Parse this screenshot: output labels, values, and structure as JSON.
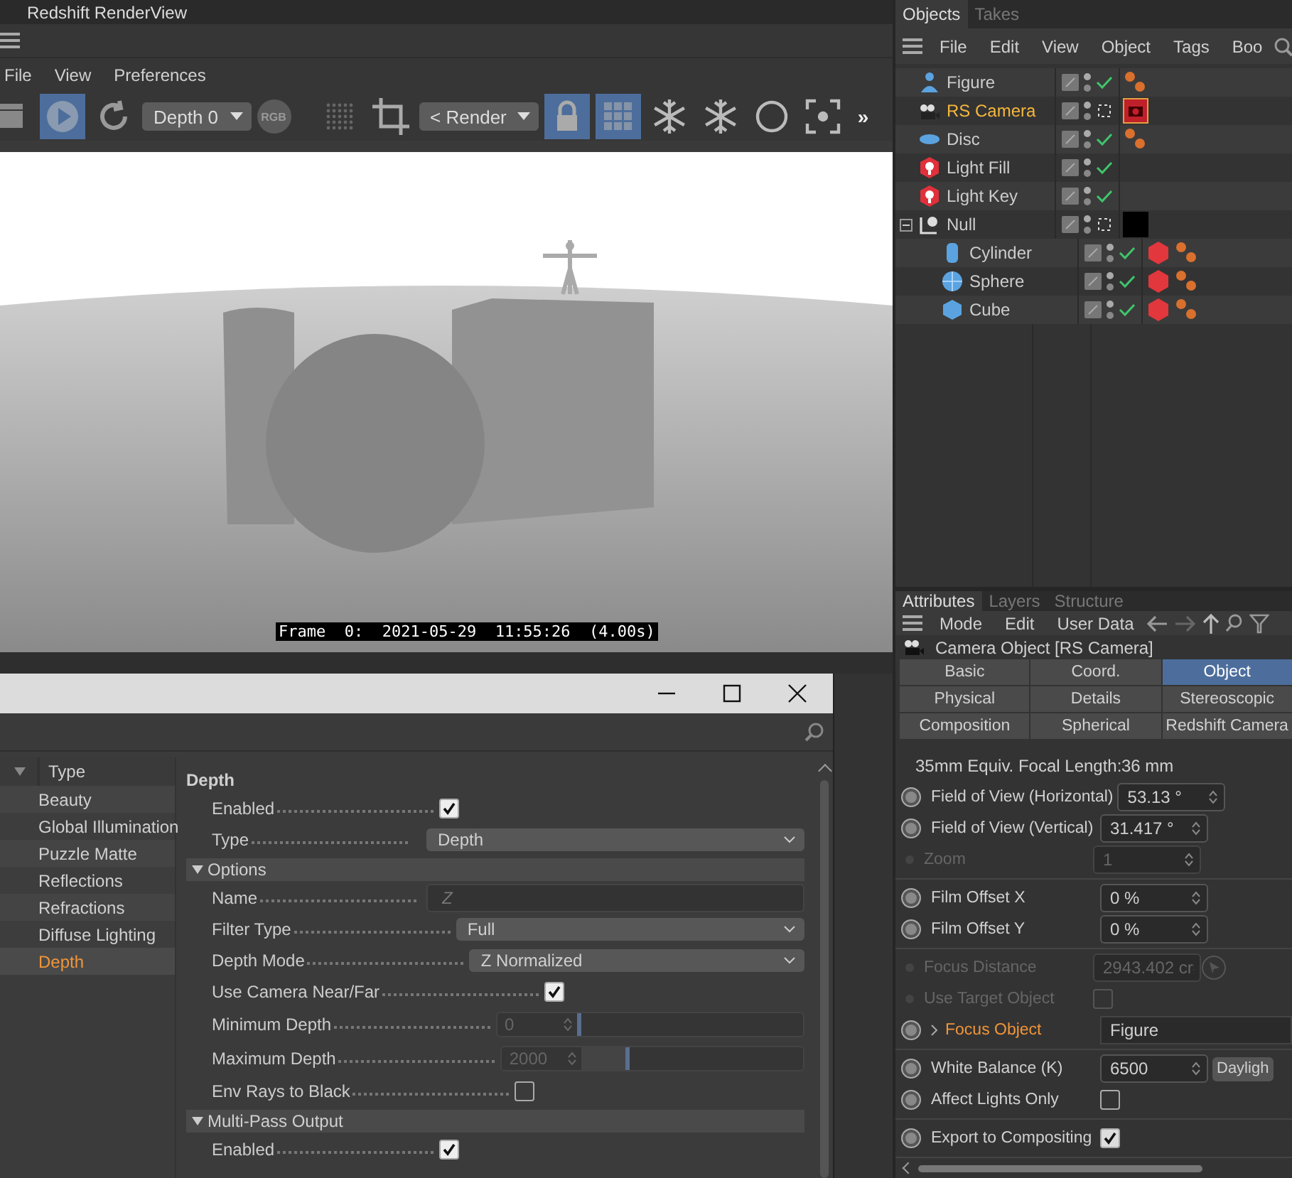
{
  "renderview": {
    "title": "Redshift RenderView",
    "menu": [
      "File",
      "View",
      "Preferences"
    ],
    "toolbar": [
      {
        "kind": "clapper",
        "on": false
      },
      {
        "kind": "play",
        "on": true
      },
      {
        "kind": "refresh",
        "on": false
      },
      {
        "kind": "select",
        "label": "Depth 0",
        "on": false
      },
      {
        "kind": "rgb",
        "label": "RGB",
        "on": false
      },
      {
        "kind": "dots",
        "on": false
      },
      {
        "kind": "crop",
        "on": false
      },
      {
        "kind": "select",
        "label": "< Render",
        "on": false
      },
      {
        "kind": "lock",
        "on": true
      },
      {
        "kind": "grid",
        "on": true
      },
      {
        "kind": "snowflake",
        "on": false
      },
      {
        "kind": "snowflake-g",
        "on": false
      },
      {
        "kind": "circle",
        "on": false
      },
      {
        "kind": "focus",
        "on": false
      },
      {
        "kind": "more",
        "label": "»",
        "on": false
      }
    ],
    "frame_label": "Frame  0:  2021-05-29  11:55:26  (4.00s)"
  },
  "objects": {
    "tabs": [
      {
        "label": "Objects",
        "selected": true
      },
      {
        "label": "Takes",
        "selected": false
      }
    ],
    "menu": [
      "File",
      "Edit",
      "View",
      "Object",
      "Tags",
      "Boo"
    ],
    "tree": [
      {
        "name": "Figure",
        "kind": "figure",
        "selected": false,
        "check": true,
        "tags": [
          {
            "kind": "phong"
          }
        ]
      },
      {
        "name": "RS Camera",
        "kind": "camera",
        "selected": true,
        "check": false,
        "tags": [
          {
            "kind": "render"
          }
        ]
      },
      {
        "name": "Disc",
        "kind": "disc",
        "selected": false,
        "check": true,
        "tags": [
          {
            "kind": "phong"
          }
        ]
      },
      {
        "name": "Light Fill",
        "kind": "light",
        "selected": false,
        "check": true
      },
      {
        "name": "Light Key",
        "kind": "light",
        "selected": false,
        "check": true
      },
      {
        "name": "Null",
        "kind": "null",
        "selected": false,
        "check": false,
        "expanded": true,
        "tags": [
          {
            "kind": "display"
          }
        ],
        "children": [
          {
            "name": "Cylinder",
            "kind": "cylinder",
            "selected": false,
            "check": true,
            "tags": [
              {
                "kind": "material"
              },
              {
                "kind": "phong"
              }
            ]
          },
          {
            "name": "Sphere",
            "kind": "sphere",
            "selected": false,
            "check": true,
            "tags": [
              {
                "kind": "material"
              },
              {
                "kind": "phong"
              }
            ]
          },
          {
            "name": "Cube",
            "kind": "cube",
            "selected": false,
            "check": true,
            "tags": [
              {
                "kind": "material"
              },
              {
                "kind": "phong"
              }
            ]
          }
        ]
      }
    ]
  },
  "attributes": {
    "tabs": [
      {
        "label": "Attributes",
        "selected": true
      },
      {
        "label": "Layers",
        "selected": false
      },
      {
        "label": "Structure",
        "selected": false
      }
    ],
    "menu": [
      "Mode",
      "Edit",
      "User Data"
    ],
    "header": "Camera Object [RS Camera]",
    "pages": [
      {
        "label": "Basic",
        "selected": false
      },
      {
        "label": "Coord.",
        "selected": false
      },
      {
        "label": "Object",
        "selected": true
      },
      {
        "label": "Physical",
        "selected": false
      },
      {
        "label": "Details",
        "selected": false
      },
      {
        "label": "Stereoscopic",
        "selected": false
      },
      {
        "label": "Composition",
        "selected": false
      },
      {
        "label": "Spherical",
        "selected": false
      },
      {
        "label": "Redshift Camera",
        "selected": false
      }
    ],
    "groups": [
      [
        {
          "kind": "info",
          "label": "35mm Equiv. Focal Length:",
          "value": "36 mm"
        },
        {
          "kind": "number",
          "label": "Field of View (Horizontal)",
          "value": "53.13 °",
          "disabled": false
        },
        {
          "kind": "number",
          "label": "Field of View (Vertical)",
          "value": "31.417 °",
          "disabled": false
        },
        {
          "kind": "number",
          "label": "Zoom",
          "value": "1",
          "disabled": true
        }
      ],
      [
        {
          "kind": "number",
          "label": "Film Offset X",
          "value": "0 %",
          "disabled": false
        },
        {
          "kind": "number",
          "label": "Film Offset Y",
          "value": "0 %",
          "disabled": false
        }
      ],
      [
        {
          "kind": "number-pick",
          "label": "Focus Distance",
          "value": "2943.402 cr",
          "disabled": true
        },
        {
          "kind": "checkbox",
          "label": "Use Target Object",
          "checked": false,
          "disabled": true
        },
        {
          "kind": "link",
          "label": "Focus Object",
          "value": "Figure",
          "disabled": false
        }
      ],
      [
        {
          "kind": "number-button",
          "label": "White Balance (K)",
          "value": "6500",
          "button": "Dayligh",
          "disabled": false
        },
        {
          "kind": "checkbox",
          "label": "Affect Lights Only",
          "checked": false,
          "disabled": false
        }
      ],
      [
        {
          "kind": "checkbox",
          "label": "Export to Compositing",
          "checked": true,
          "disabled": false
        }
      ]
    ]
  },
  "dialog": {
    "list_header": "Type",
    "passes": [
      {
        "label": "Beauty",
        "selected": false
      },
      {
        "label": "Global Illumination",
        "selected": false
      },
      {
        "label": "Puzzle Matte",
        "selected": false
      },
      {
        "label": "Reflections",
        "selected": false
      },
      {
        "label": "Refractions",
        "selected": false
      },
      {
        "label": "Diffuse Lighting",
        "selected": false
      },
      {
        "label": "Depth",
        "selected": true
      }
    ],
    "section_title": "Depth",
    "rows": [
      {
        "kind": "checkbox",
        "label": "Enabled",
        "checked": true
      },
      {
        "kind": "select",
        "label": "Type",
        "value": "Depth"
      },
      {
        "kind": "section",
        "label": "Options",
        "expanded": true
      },
      {
        "kind": "text",
        "label": "Name",
        "placeholder": "Z"
      },
      {
        "kind": "select",
        "label": "Filter Type",
        "value": "Full"
      },
      {
        "kind": "select",
        "label": "Depth Mode",
        "value": "Z Normalized"
      },
      {
        "kind": "checkbox",
        "label": "Use Camera Near/Far",
        "checked": true
      },
      {
        "kind": "slider",
        "label": "Minimum Depth",
        "value": "0",
        "level": 0,
        "disabled": true
      },
      {
        "kind": "slider",
        "label": "Maximum Depth",
        "value": "2000",
        "level": 0.2,
        "disabled": true
      },
      {
        "kind": "checkbox",
        "label": "Env Rays to Black",
        "checked": false
      },
      {
        "kind": "section",
        "label": "Multi-Pass Output",
        "expanded": true
      },
      {
        "kind": "checkbox",
        "label": "Enabled",
        "checked": true
      }
    ]
  }
}
